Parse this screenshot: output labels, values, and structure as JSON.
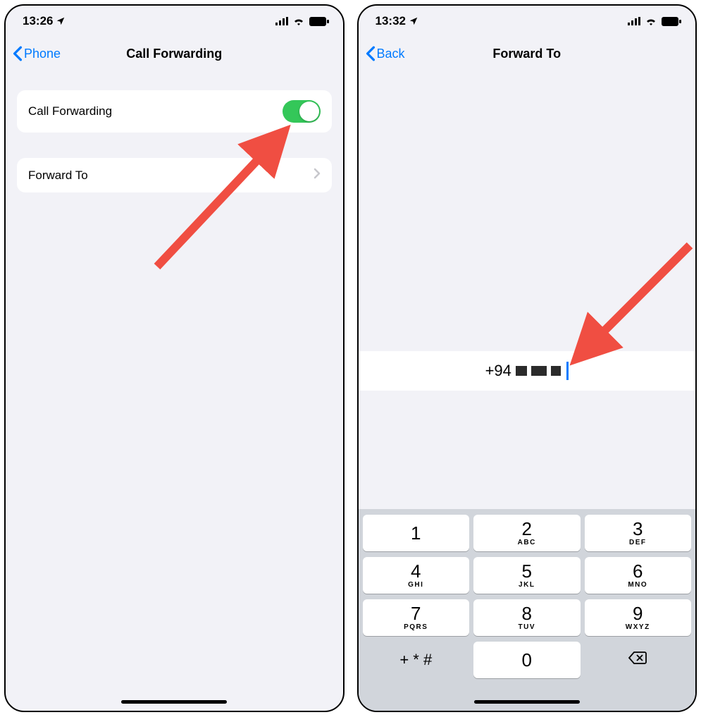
{
  "left": {
    "status": {
      "time": "13:26"
    },
    "nav": {
      "back": "Phone",
      "title": "Call Forwarding"
    },
    "rows": {
      "toggle_label": "Call Forwarding",
      "toggle_on": true,
      "forward_label": "Forward To"
    }
  },
  "right": {
    "status": {
      "time": "13:32"
    },
    "nav": {
      "back": "Back",
      "title": "Forward To"
    },
    "number": {
      "prefix": "+94"
    },
    "keypad": {
      "keys": [
        {
          "d": "1",
          "l": ""
        },
        {
          "d": "2",
          "l": "ABC"
        },
        {
          "d": "3",
          "l": "DEF"
        },
        {
          "d": "4",
          "l": "GHI"
        },
        {
          "d": "5",
          "l": "JKL"
        },
        {
          "d": "6",
          "l": "MNO"
        },
        {
          "d": "7",
          "l": "PQRS"
        },
        {
          "d": "8",
          "l": "TUV"
        },
        {
          "d": "9",
          "l": "WXYZ"
        }
      ],
      "symbols": "+ * #",
      "zero": "0"
    }
  },
  "annotation": {
    "arrow_color": "#f04e42"
  }
}
